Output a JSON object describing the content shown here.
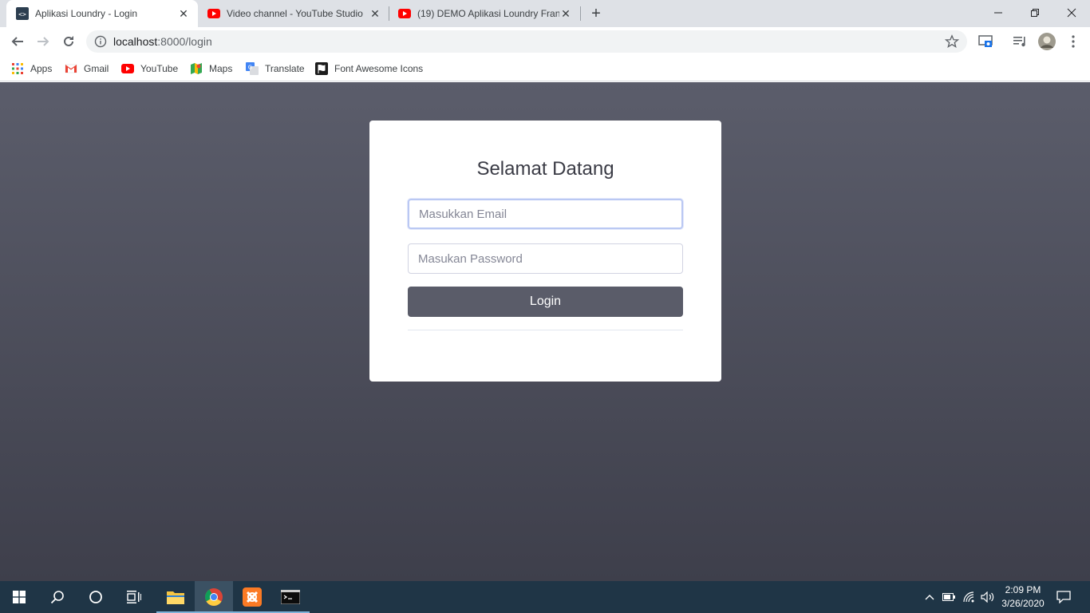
{
  "browser": {
    "tabs": [
      {
        "title": "Aplikasi Loundry - Login",
        "active": true,
        "favicon": "code-icon"
      },
      {
        "title": "Video channel - YouTube Studio",
        "active": false,
        "favicon": "youtube-icon"
      },
      {
        "title": "(19) DEMO Aplikasi Loundry Fran",
        "active": false,
        "favicon": "youtube-icon"
      }
    ],
    "new_tab": "+",
    "url_host": "localhost",
    "url_rest": ":8000/login",
    "bookmarks": [
      {
        "label": "Apps",
        "icon": "apps-grid-icon"
      },
      {
        "label": "Gmail",
        "icon": "gmail-icon"
      },
      {
        "label": "YouTube",
        "icon": "youtube-icon"
      },
      {
        "label": "Maps",
        "icon": "maps-icon"
      },
      {
        "label": "Translate",
        "icon": "translate-icon"
      },
      {
        "label": "Font Awesome Icons",
        "icon": "font-awesome-icon"
      }
    ]
  },
  "login": {
    "title": "Selamat Datang",
    "email_placeholder": "Masukkan Email",
    "email_value": "",
    "password_placeholder": "Masukan Password",
    "password_value": "",
    "button_label": "Login"
  },
  "colors": {
    "page_bg_top": "#5b5d6b",
    "page_bg_bottom": "#3e3f4b",
    "button_bg": "#5a5c69",
    "taskbar_bg": "#1f3546"
  },
  "taskbar": {
    "time": "2:09 PM",
    "date": "3/26/2020"
  }
}
